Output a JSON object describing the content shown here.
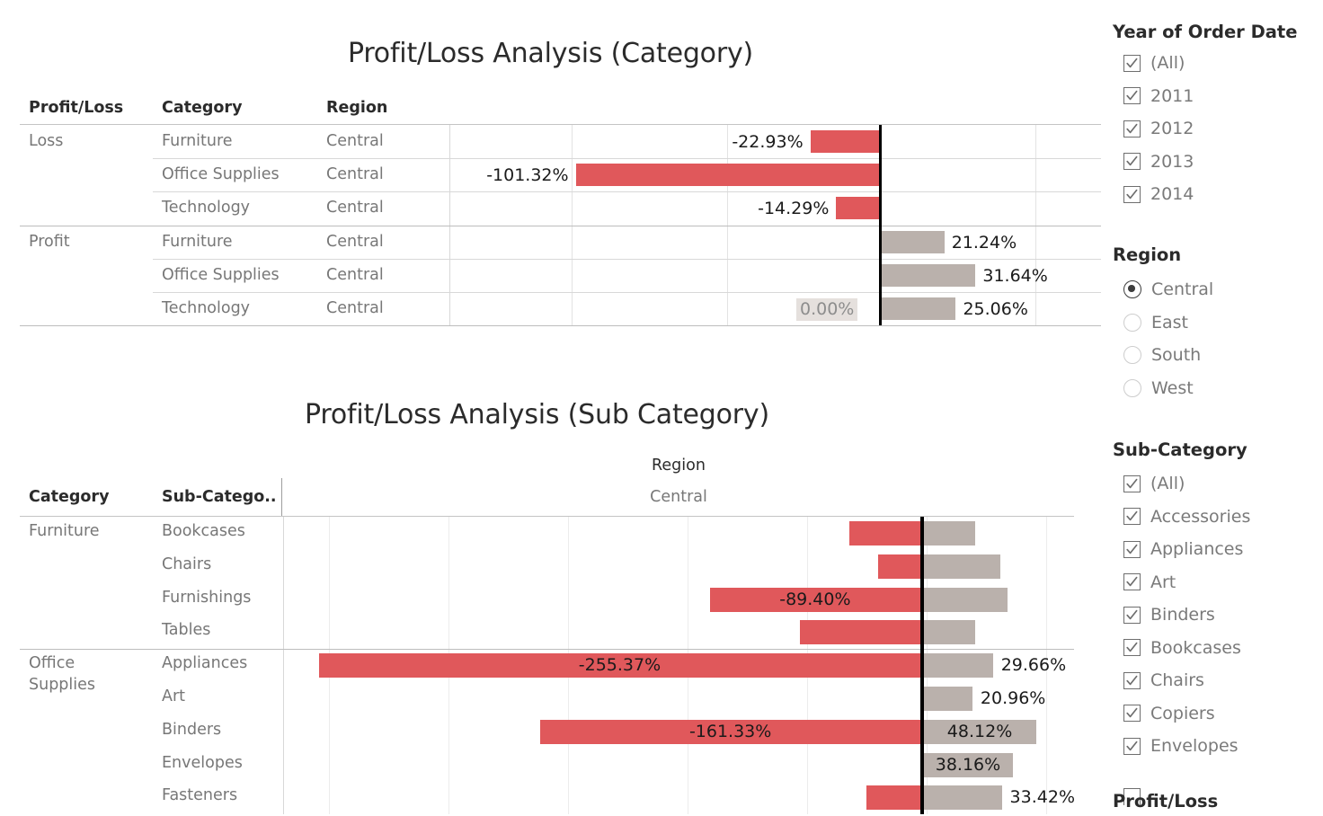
{
  "colors": {
    "loss": "#e0585b",
    "profit": "#bab1ac",
    "zero_line": "#000000",
    "text": "#777777",
    "header_text": "#2b2b2b"
  },
  "chart_data": [
    {
      "type": "bar",
      "title": "Profit/Loss Analysis (Category)",
      "orientation": "horizontal",
      "xlabel": "",
      "ylabel": "",
      "grid": true,
      "legend": "none",
      "columns": [
        "Profit/Loss",
        "Category",
        "Region"
      ],
      "rows": [
        {
          "profit_loss": "Loss",
          "category": "Furniture",
          "region": "Central",
          "value": -22.93,
          "label": "-22.93%",
          "label_pos": "outside-left"
        },
        {
          "profit_loss": "",
          "category": "Office Supplies",
          "region": "Central",
          "value": -101.32,
          "label": "-101.32%",
          "label_pos": "outside-left"
        },
        {
          "profit_loss": "",
          "category": "Technology",
          "region": "Central",
          "value": -14.29,
          "label": "-14.29%",
          "label_pos": "outside-left"
        },
        {
          "profit_loss": "Profit",
          "category": "Furniture",
          "region": "Central",
          "value": 21.24,
          "label": "21.24%",
          "label_pos": "outside-right"
        },
        {
          "profit_loss": "",
          "category": "Office Supplies",
          "region": "Central",
          "value": 31.64,
          "label": "31.64%",
          "label_pos": "outside-right"
        },
        {
          "profit_loss": "",
          "category": "Technology",
          "region": "Central",
          "value": 25.06,
          "label": "25.06%",
          "label_pos": "outside-right",
          "zero_label": "0.00%"
        }
      ]
    },
    {
      "type": "bar",
      "title": "Profit/Loss Analysis (Sub Category)",
      "orientation": "horizontal",
      "column_header": "Region",
      "column_value": "Central",
      "grid": true,
      "legend": "none",
      "columns": [
        "Category",
        "Sub-Catego.."
      ],
      "rows": [
        {
          "category": "Furniture",
          "sub_category": "Bookcases",
          "loss": -30.0,
          "profit": 22.0,
          "loss_label": "",
          "profit_label": ""
        },
        {
          "category": "",
          "sub_category": "Chairs",
          "loss": -18.0,
          "profit": 33.0,
          "loss_label": "",
          "profit_label": ""
        },
        {
          "category": "",
          "sub_category": "Furnishings",
          "loss": -89.4,
          "profit": 36.0,
          "loss_label": "-89.40%",
          "profit_label": ""
        },
        {
          "category": "",
          "sub_category": "Tables",
          "loss": -51.0,
          "profit": 22.0,
          "loss_label": "",
          "profit_label": ""
        },
        {
          "category": "Office Supplies",
          "sub_category": "Appliances",
          "loss": -255.37,
          "profit": 29.66,
          "loss_label": "-255.37%",
          "profit_label": "29.66%"
        },
        {
          "category": "",
          "sub_category": "Art",
          "loss": 0,
          "profit": 20.96,
          "loss_label": "",
          "profit_label": "20.96%"
        },
        {
          "category": "",
          "sub_category": "Binders",
          "loss": -161.33,
          "profit": 48.12,
          "loss_label": "-161.33%",
          "profit_label": "48.12%"
        },
        {
          "category": "",
          "sub_category": "Envelopes",
          "loss": 0,
          "profit": 38.16,
          "loss_label": "",
          "profit_label": "38.16%"
        },
        {
          "category": "",
          "sub_category": "Fasteners",
          "loss": -23.0,
          "profit": 33.42,
          "loss_label": "",
          "profit_label": "33.42%"
        }
      ]
    }
  ],
  "panel": {
    "year_filter": {
      "title": "Year of Order Date",
      "items": [
        {
          "label": "(All)",
          "checked": true
        },
        {
          "label": "2011",
          "checked": true
        },
        {
          "label": "2012",
          "checked": true
        },
        {
          "label": "2013",
          "checked": true
        },
        {
          "label": "2014",
          "checked": true
        }
      ]
    },
    "region_filter": {
      "title": "Region",
      "items": [
        {
          "label": "Central",
          "selected": true
        },
        {
          "label": "East",
          "selected": false
        },
        {
          "label": "South",
          "selected": false
        },
        {
          "label": "West",
          "selected": false
        }
      ]
    },
    "subcategory_filter": {
      "title": "Sub-Category",
      "items": [
        {
          "label": "(All)",
          "checked": true
        },
        {
          "label": "Accessories",
          "checked": true
        },
        {
          "label": "Appliances",
          "checked": true
        },
        {
          "label": "Art",
          "checked": true
        },
        {
          "label": "Binders",
          "checked": true
        },
        {
          "label": "Bookcases",
          "checked": true
        },
        {
          "label": "Chairs",
          "checked": true
        },
        {
          "label": "Copiers",
          "checked": true
        },
        {
          "label": "Envelopes",
          "checked": true
        }
      ]
    },
    "profitloss_filter": {
      "title": "Profit/Loss"
    }
  }
}
